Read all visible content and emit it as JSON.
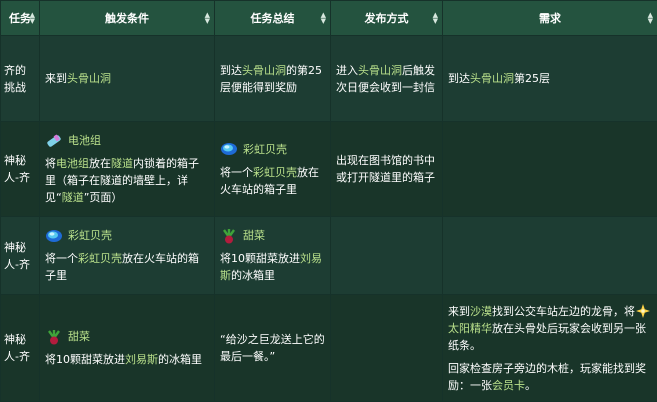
{
  "headers": [
    "任务",
    "触发条件",
    "任务总结",
    "发布方式",
    "需求"
  ],
  "colors": {
    "link": "#b9e08b",
    "header_bg": "#24533f",
    "row_bg": "#1d3d33"
  },
  "rows": [
    {
      "quest": "齐的挑战",
      "trigger": {
        "pre": "来到",
        "link": "头骨山洞",
        "post": ""
      },
      "summary": {
        "pre": "到达",
        "link": "头骨山洞",
        "post": "的第25层便能得到奖励"
      },
      "release": {
        "pre": "进入",
        "link": "头骨山洞",
        "post": "后触发次日便会收到一封信"
      },
      "req": {
        "pre": "到达",
        "link": "头骨山洞",
        "post": "第25层"
      }
    },
    {
      "quest": "神秘人-齐",
      "trigger": {
        "item": "电池组",
        "icon": "battery-pack-icon",
        "t1": "将",
        "l1": "电池组",
        "t2": "放在",
        "l2": "隧道",
        "t3": "内锁着的箱子里（箱子在隧道的墙壁上，详见“",
        "l3": "隧道",
        "t4": "”页面）"
      },
      "summary": {
        "item": "彩虹贝壳",
        "icon": "rainbow-shell-icon",
        "t1": "将一个",
        "l1": "彩虹贝壳",
        "t2": "放在火车站的箱子里"
      },
      "release": "出现在图书馆的书中或打开隧道里的箱子"
    },
    {
      "quest": "神秘人-齐",
      "trigger": {
        "item": "彩虹贝壳",
        "icon": "rainbow-shell-icon",
        "t1": "将一个",
        "l1": "彩虹贝壳",
        "t2": "放在火车站的箱子里"
      },
      "summary": {
        "item": "甜菜",
        "icon": "beet-icon",
        "t1": "将10颗甜菜放进",
        "l1": "刘易斯",
        "t2": "的冰箱里"
      }
    },
    {
      "quest": "神秘人-齐",
      "trigger": {
        "item": "甜菜",
        "icon": "beet-icon",
        "t1": "将10颗甜菜放进",
        "l1": "刘易斯",
        "t2": "的冰箱里"
      },
      "summary": "“给沙之巨龙送上它的最后一餐。”",
      "req": {
        "p1a": "来到",
        "p1l": "沙漠",
        "p1b": "找到公交车站左边的龙骨，将",
        "item": "太阳精华",
        "icon": "solar-essence-icon",
        "p1c": "放在头骨处后玩家会收到另一张纸条。",
        "p2a": "回家检查房子旁边的木桩，玩家能找到奖励：一张",
        "p2l": "会员卡",
        "p2b": "。"
      }
    }
  ]
}
